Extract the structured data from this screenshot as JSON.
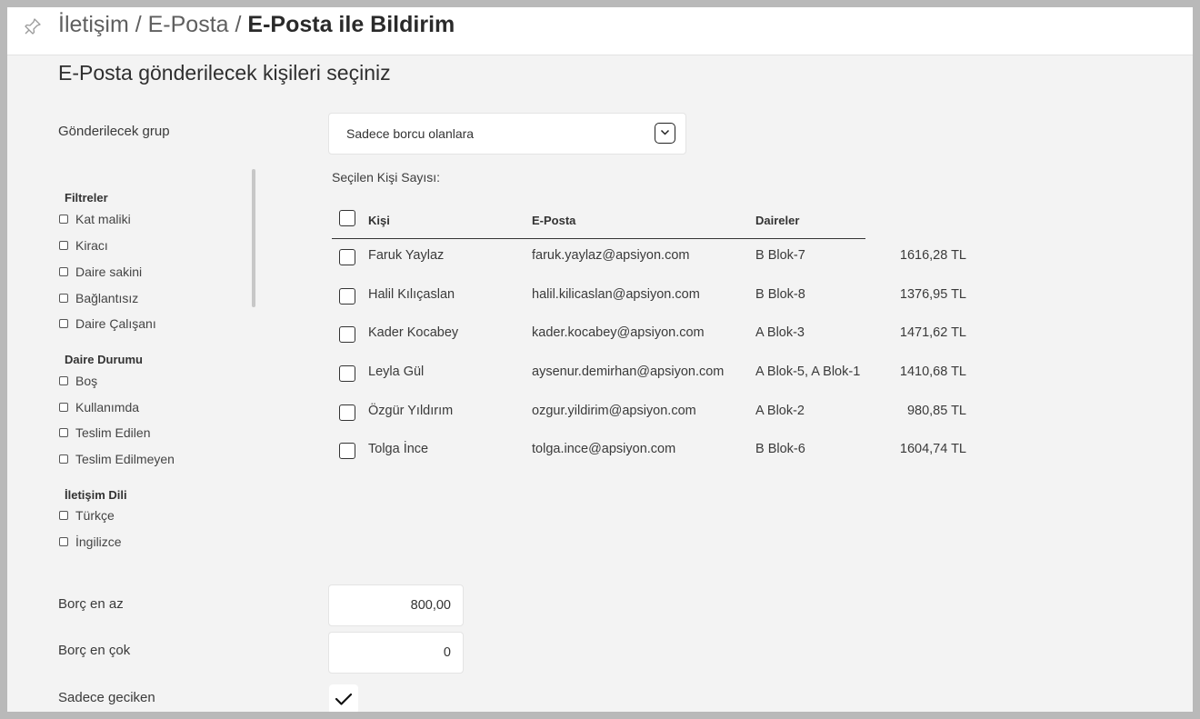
{
  "breadcrumb": {
    "part1": "İletişim / E-Posta /",
    "current": "E-Posta ile Bildirim"
  },
  "page_title": "E-Posta gönderilecek kişileri seçiniz",
  "group": {
    "label": "Gönderilecek grup",
    "selected": "Sadece borcu olanlara"
  },
  "filters": {
    "groups": [
      {
        "title": "Filtreler",
        "options": [
          "Kat maliki",
          "Kiracı",
          "Daire sakini",
          "Bağlantısız",
          "Daire Çalışanı"
        ]
      },
      {
        "title": "Daire Durumu",
        "options": [
          "Boş",
          "Kullanımda",
          "Teslim Edilen",
          "Teslim Edilmeyen"
        ]
      },
      {
        "title": "İletişim Dili",
        "options": [
          "Türkçe",
          "İngilizce"
        ]
      }
    ]
  },
  "selected_count_label": "Seçilen Kişi Sayısı:",
  "table": {
    "columns": [
      "Kişi",
      "E-Posta",
      "Daireler"
    ],
    "rows": [
      {
        "name": "Faruk Yaylaz",
        "email": "faruk.yaylaz@apsiyon.com",
        "units": "B Blok-7",
        "amount": "1616,28 TL"
      },
      {
        "name": "Halil Kılıçaslan",
        "email": "halil.kilicaslan@apsiyon.com",
        "units": "B Blok-8",
        "amount": "1376,95 TL"
      },
      {
        "name": "Kader Kocabey",
        "email": "kader.kocabey@apsiyon.com",
        "units": "A Blok-3",
        "amount": "1471,62 TL"
      },
      {
        "name": "Leyla Gül",
        "email": "aysenur.demirhan@apsiyon.com",
        "units": "A Blok-5, A Blok-1",
        "amount": "1410,68 TL"
      },
      {
        "name": "Özgür Yıldırım",
        "email": "ozgur.yildirim@apsiyon.com",
        "units": "A Blok-2",
        "amount": "980,85 TL"
      },
      {
        "name": "Tolga İnce",
        "email": "tolga.ince@apsiyon.com",
        "units": "B Blok-6",
        "amount": "1604,74 TL"
      }
    ]
  },
  "debt_min": {
    "label": "Borç en az",
    "value": "800,00"
  },
  "debt_max": {
    "label": "Borç en çok",
    "value": "0"
  },
  "only_overdue": {
    "label": "Sadece geciken",
    "checked": true
  }
}
